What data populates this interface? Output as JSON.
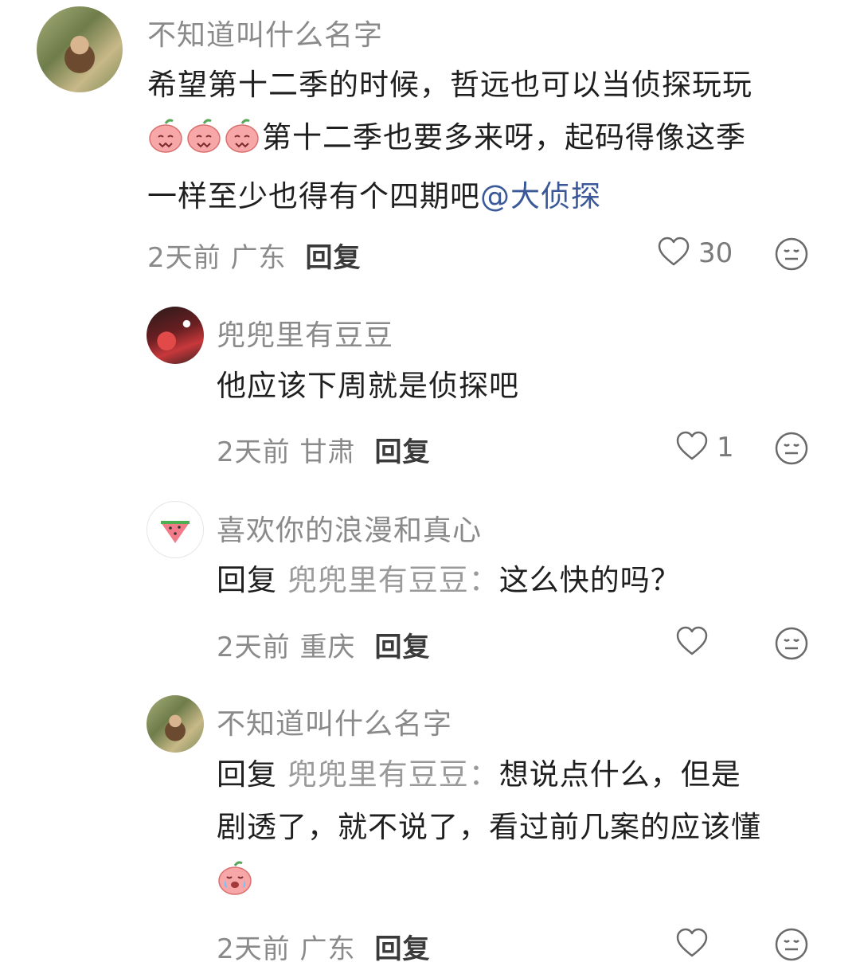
{
  "comments": [
    {
      "username": "不知道叫什么名字",
      "text_line1": "希望第十二季的时候，哲远也可以当侦探玩玩",
      "text_line2": "第十二季也要多来呀，起码得像这季",
      "text_line3": "一样至少也得有个四期吧",
      "mention": "@大侦探",
      "meta": "2天前 广东",
      "reply_label": "回复",
      "likes": "30",
      "avatar_icon": "avatar-portrait",
      "emoji_icon": "pink-peach-blush-emoji"
    },
    {
      "username": "兜兜里有豆豆",
      "text": "他应该下周就是侦探吧",
      "meta": "2天前 甘肃",
      "reply_label": "回复",
      "likes": "1",
      "avatar_icon": "avatar-red-photo"
    },
    {
      "username": "喜欢你的浪漫和真心",
      "reply_prefix": "回复",
      "reply_target": "兜兜里有豆豆：",
      "text": "这么快的吗？",
      "meta": "2天前 重庆",
      "reply_label": "回复",
      "likes": "",
      "avatar_icon": "watermelon-icon"
    },
    {
      "username": "不知道叫什么名字",
      "reply_prefix": "回复",
      "reply_target": "兜兜里有豆豆：",
      "text_line1": "想说点什么，但是",
      "text_line2": "剧透了，就不说了，看过前几案的应该懂",
      "meta": "2天前 广东",
      "reply_label": "回复",
      "likes": "",
      "avatar_icon": "avatar-portrait",
      "emoji_icon": "crying-peach-emoji"
    }
  ],
  "colors": {
    "mention": "#3b5998",
    "meta": "#8a8a8a",
    "text": "#1f1f1f"
  }
}
